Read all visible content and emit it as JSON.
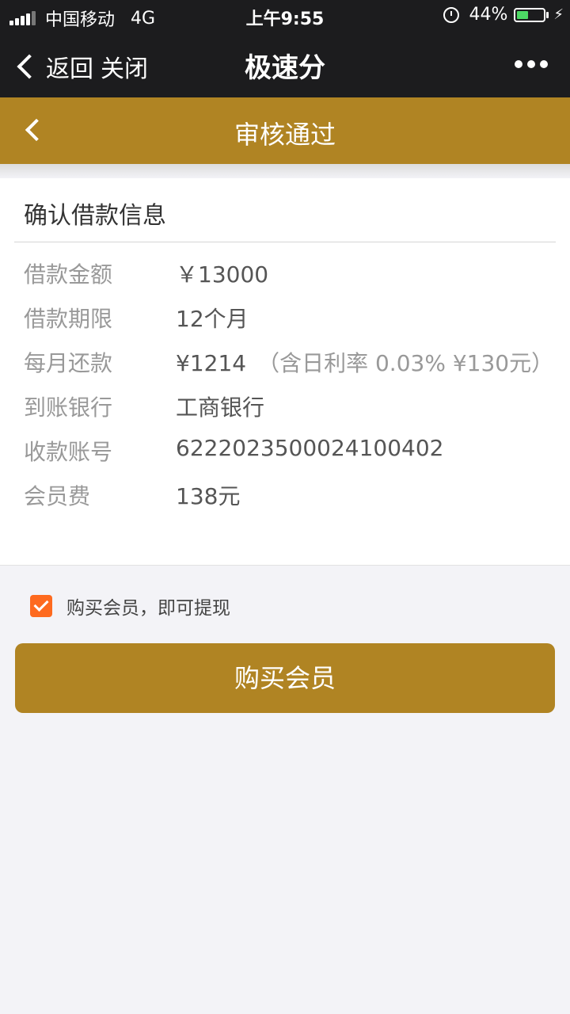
{
  "status_bar": {
    "carrier": "中国移动",
    "network": "4G",
    "time": "上午9:55",
    "battery_percent": "44%",
    "battery_level": 0.44,
    "icons": [
      "signal-icon",
      "alarm-icon",
      "battery-icon",
      "charging-icon"
    ]
  },
  "nav": {
    "back_label": "返回",
    "close_label": "关闭",
    "title": "极速分",
    "more_icon": "more-icon"
  },
  "header": {
    "title": "审核通过",
    "back_icon": "chevron-left-icon"
  },
  "loan_info": {
    "title": "确认借款信息",
    "rows": [
      {
        "label": "借款金额",
        "value": "￥13000",
        "note": ""
      },
      {
        "label": "借款期限",
        "value": "12个月",
        "note": ""
      },
      {
        "label": "每月还款",
        "value": "¥1214",
        "note": "（含日利率 0.03% ¥130元）"
      },
      {
        "label": "到账银行",
        "value": "工商银行",
        "note": ""
      },
      {
        "label": "收款账号",
        "value": "6222023500024100402",
        "note": ""
      },
      {
        "label": "会员费",
        "value": "138元",
        "note": ""
      }
    ]
  },
  "agreement": {
    "checked": true,
    "text": "购买会员，即可提现"
  },
  "action": {
    "buy_label": "购买会员"
  },
  "colors": {
    "gold": "#b08423",
    "dark": "#1c1c1e",
    "checkbox": "#fe6a1f",
    "battery": "#4cd964"
  }
}
